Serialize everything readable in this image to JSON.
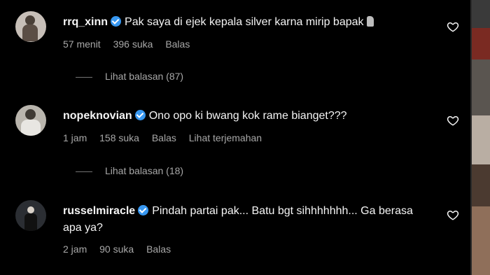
{
  "comments": [
    {
      "username": "rrq_xinn",
      "text": "Pak saya di ejek kepala silver karna mirip bapak",
      "emoji": "moai-emoji",
      "time": "57 menit",
      "likes": "396 suka",
      "reply": "Balas",
      "replies_label": "Lihat balasan (87)"
    },
    {
      "username": "nopeknovian",
      "text": "Ono opo ki bwang kok rame bianget???",
      "time": "1 jam",
      "likes": "158 suka",
      "reply": "Balas",
      "translate": "Lihat terjemahan",
      "replies_label": "Lihat balasan (18)"
    },
    {
      "username": "russelmiracle",
      "text": "Pindah partai pak... Batu bgt sihhhhhhh... Ga berasa apa ya?",
      "time": "2 jam",
      "likes": "90 suka",
      "reply": "Balas"
    }
  ],
  "colors": {
    "background": "#000000",
    "text": "#f5f5f5",
    "muted": "#a8a8a8",
    "verified": "#3797f0"
  }
}
